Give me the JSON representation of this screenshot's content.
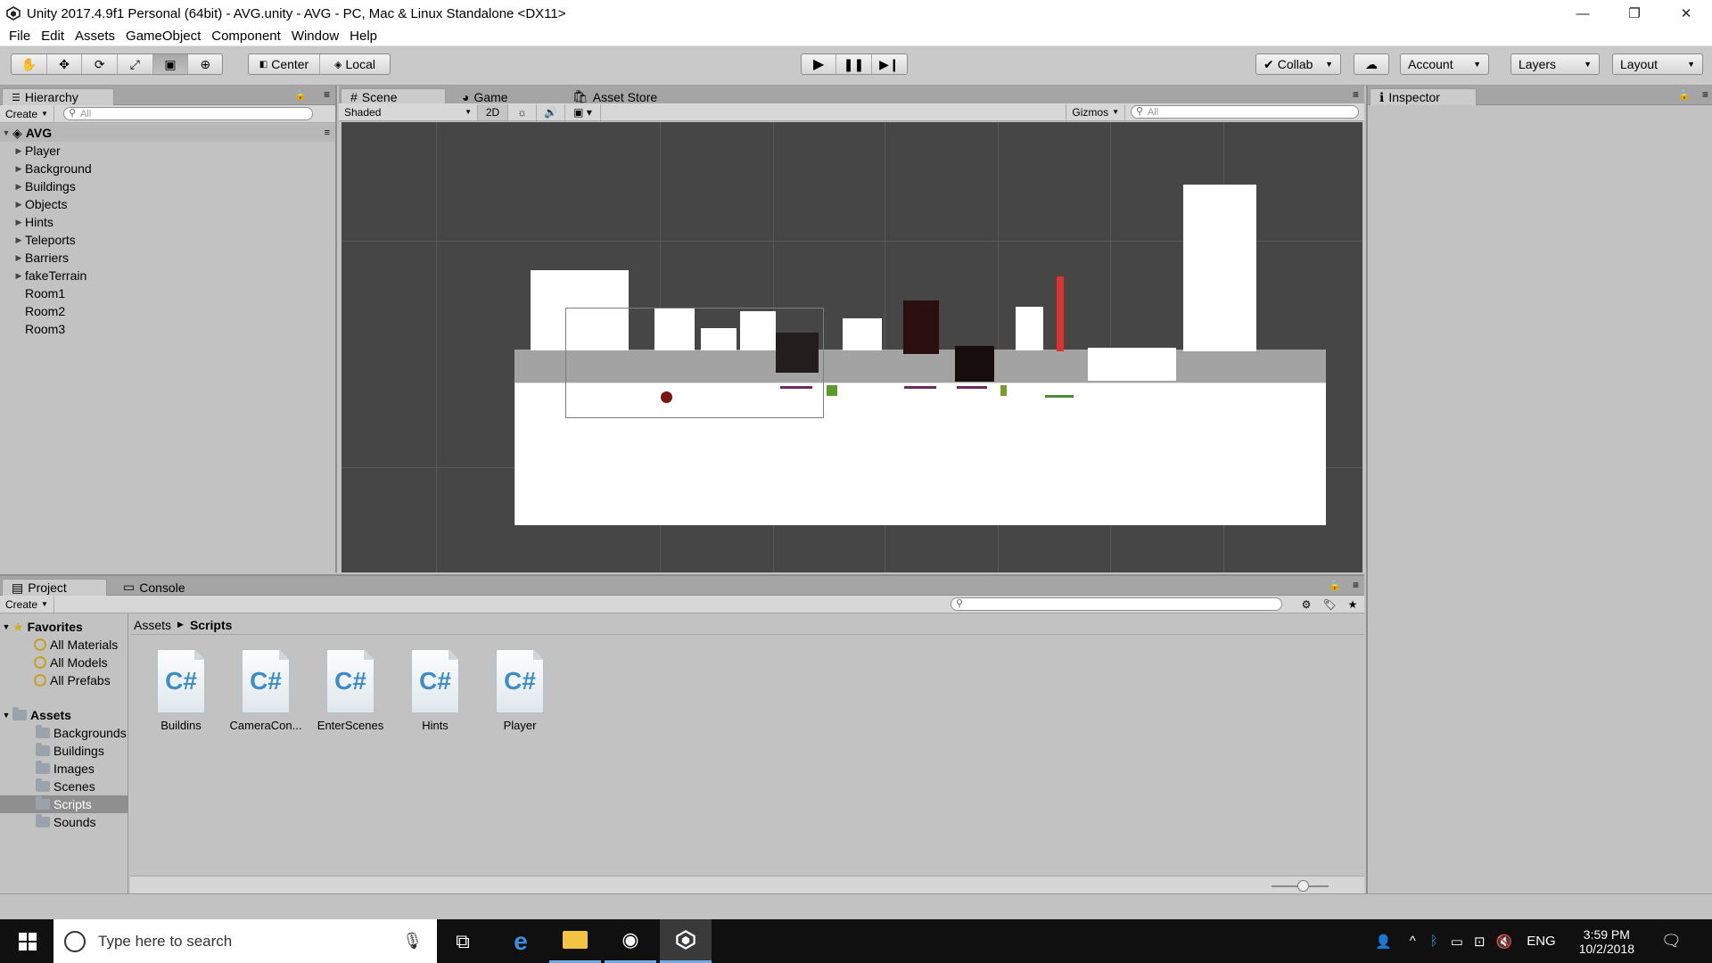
{
  "window": {
    "title": "Unity 2017.4.9f1 Personal (64bit) - AVG.unity - AVG - PC, Mac & Linux Standalone <DX11>",
    "minimize": "—",
    "restore": "❐",
    "close": "✕"
  },
  "menu": [
    "File",
    "Edit",
    "Assets",
    "GameObject",
    "Component",
    "Window",
    "Help"
  ],
  "toolbar": {
    "center_label": "Center",
    "local_label": "Local",
    "collab_label": "Collab",
    "account_label": "Account",
    "layers_label": "Layers",
    "layout_label": "Layout"
  },
  "hierarchy": {
    "tab": "Hierarchy",
    "create": "Create",
    "search_placeholder": "All",
    "scene_name": "AVG",
    "items": [
      {
        "label": "Player",
        "expandable": true
      },
      {
        "label": "Background",
        "expandable": true
      },
      {
        "label": "Buildings",
        "expandable": true
      },
      {
        "label": "Objects",
        "expandable": true
      },
      {
        "label": "Hints",
        "expandable": true
      },
      {
        "label": "Teleports",
        "expandable": true
      },
      {
        "label": "Barriers",
        "expandable": true
      },
      {
        "label": "fakeTerrain",
        "expandable": true
      },
      {
        "label": "Room1",
        "expandable": false
      },
      {
        "label": "Room2",
        "expandable": false
      },
      {
        "label": "Room3",
        "expandable": false
      }
    ]
  },
  "scene_view": {
    "tabs": [
      "Scene",
      "Game",
      "Asset Store"
    ],
    "shading": "Shaded",
    "mode_2d": "2D",
    "gizmos": "Gizmos",
    "search_placeholder": "All"
  },
  "inspector": {
    "tab": "Inspector"
  },
  "project": {
    "tabs": [
      "Project",
      "Console"
    ],
    "create": "Create",
    "favorites_label": "Favorites",
    "favorites": [
      "All Materials",
      "All Models",
      "All Prefabs"
    ],
    "assets_label": "Assets",
    "folders": [
      "Backgrounds",
      "Buildings",
      "Images",
      "Scenes",
      "Scripts",
      "Sounds"
    ],
    "selected_folder": "Scripts",
    "breadcrumb": [
      "Assets",
      "Scripts"
    ],
    "files": [
      "Buildins",
      "CameraCon...",
      "EnterScenes",
      "Hints",
      "Player"
    ],
    "file_glyph": "C#"
  },
  "taskbar": {
    "search_placeholder": "Type here to search",
    "language": "ENG",
    "time": "3:59 PM",
    "date": "10/2/2018"
  }
}
